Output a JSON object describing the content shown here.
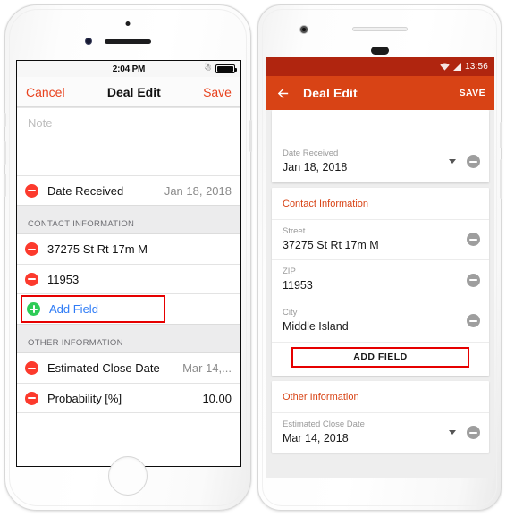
{
  "ios": {
    "status_bar": {
      "time": "2:04 PM",
      "bluetooth_icon": "bluetooth-icon",
      "battery_icon": "battery-full-icon"
    },
    "nav_bar": {
      "cancel_label": "Cancel",
      "title": "Deal Edit",
      "save_label": "Save"
    },
    "note": {
      "placeholder": "Note",
      "value": ""
    },
    "rows": [
      {
        "name": "date-received",
        "label": "Date Received",
        "value": "Jan 18, 2018",
        "icon": "minus-circle-icon"
      }
    ],
    "sections": [
      {
        "name": "contact-information",
        "header": "CONTACT INFORMATION",
        "rows": [
          {
            "name": "street",
            "label": "37275 St  Rt 17m M",
            "value": "",
            "icon": "minus-circle-icon"
          },
          {
            "name": "zip",
            "label": "11953",
            "value": "",
            "icon": "minus-circle-icon"
          }
        ],
        "add_field_label": "Add Field",
        "add_field_icon": "plus-circle-icon"
      },
      {
        "name": "other-information",
        "header": "OTHER INFORMATION",
        "rows": [
          {
            "name": "estimated-close-date",
            "label": "Estimated Close Date",
            "value": "Mar 14,...",
            "icon": "minus-circle-icon"
          },
          {
            "name": "probability",
            "label": "Probability [%]",
            "value": "10.00",
            "icon": "minus-circle-icon"
          }
        ]
      }
    ]
  },
  "android": {
    "status_bar": {
      "time": "13:56",
      "wifi_icon": "wifi-icon",
      "signal_icon": "signal-icon"
    },
    "app_bar": {
      "back_icon": "arrow-back-icon",
      "title": "Deal Edit",
      "save_label": "SAVE"
    },
    "cards": [
      {
        "name": "general-card",
        "title": "",
        "fields": [
          {
            "name": "date-received",
            "label": "Date Received",
            "value": "Jan 18, 2018",
            "has_caret": true,
            "icon": "minus-circle-icon"
          }
        ]
      },
      {
        "name": "contact-information-card",
        "title": "Contact Information",
        "fields": [
          {
            "name": "street",
            "label": "Street",
            "value": "37275 St  Rt 17m M",
            "has_caret": false,
            "icon": "minus-circle-icon"
          },
          {
            "name": "zip",
            "label": "ZIP",
            "value": "11953",
            "has_caret": false,
            "icon": "minus-circle-icon"
          },
          {
            "name": "city",
            "label": "City",
            "value": "Middle Island",
            "has_caret": false,
            "icon": "minus-circle-icon"
          }
        ],
        "add_field_label": "ADD FIELD"
      },
      {
        "name": "other-information-card",
        "title": "Other Information",
        "fields": [
          {
            "name": "estimated-close-date",
            "label": "Estimated Close Date",
            "value": "Mar 14, 2018",
            "has_caret": true,
            "icon": "minus-circle-icon"
          }
        ]
      }
    ]
  },
  "colors": {
    "ios_accent": "#e8431f",
    "ios_link": "#2f7cf6",
    "ios_minus": "#fc3a2d",
    "ios_plus": "#2ecc57",
    "android_appbar": "#d84315",
    "android_statusbar": "#b0250f",
    "android_minus": "#9e9e9e",
    "highlight_outline": "#e60000"
  }
}
